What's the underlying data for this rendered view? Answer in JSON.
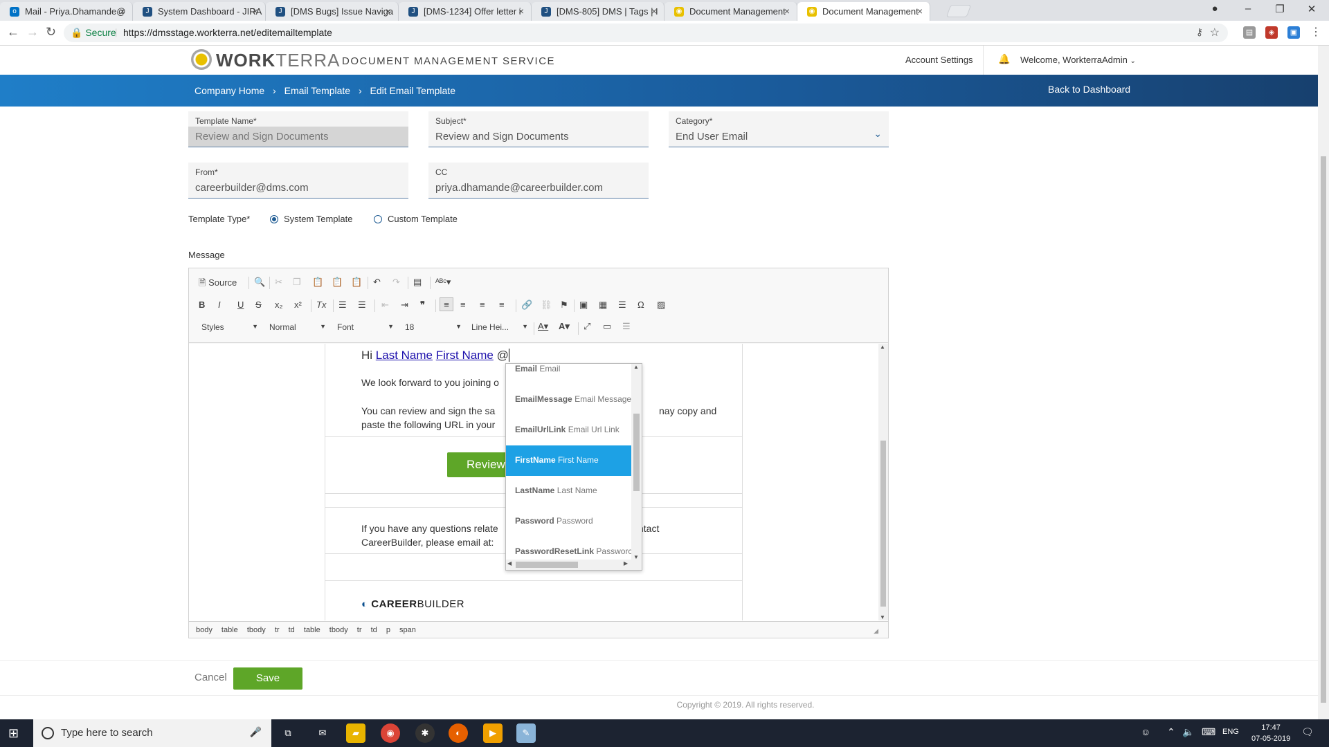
{
  "browser": {
    "tabs": [
      {
        "label": "Mail - Priya.Dhamande@",
        "icon": "outlook-icon",
        "color": "#0072c6"
      },
      {
        "label": "System Dashboard - JIRA",
        "icon": "jira-icon",
        "color": "#205081"
      },
      {
        "label": "[DMS Bugs] Issue Naviga",
        "icon": "jira-icon",
        "color": "#205081"
      },
      {
        "label": "[DMS-1234] Offer letter i",
        "icon": "jira-icon",
        "color": "#205081"
      },
      {
        "label": "[DMS-805] DMS | Tags | I",
        "icon": "jira-icon",
        "color": "#205081"
      },
      {
        "label": "Document Management",
        "icon": "workterra-icon",
        "color": "#e8c000"
      },
      {
        "label": "Document Management",
        "icon": "workterra-icon",
        "color": "#e8c000"
      }
    ],
    "secure_label": "Secure",
    "url": "https://dmsstage.workterra.net/editemailtemplate"
  },
  "header": {
    "brand_bold": "WORK",
    "brand_light": "TERRA",
    "service_title": "DOCUMENT MANAGEMENT SERVICE",
    "account_settings": "Account Settings",
    "welcome": "Welcome, WorkterraAdmin"
  },
  "nav": {
    "breadcrumb": [
      "Company Home",
      "›",
      "Email Template",
      "›",
      "Edit Email Template"
    ],
    "back_to_dashboard": "Back to Dashboard",
    "bar_color": "#1f7ec8"
  },
  "form": {
    "template_name": {
      "label": "Template Name*",
      "value": "Review and Sign Documents"
    },
    "subject": {
      "label": "Subject*",
      "value": "Review and Sign Documents"
    },
    "category": {
      "label": "Category*",
      "value": "End User Email"
    },
    "from": {
      "label": "From*",
      "value": "careerbuilder@dms.com"
    },
    "cc": {
      "label": "CC",
      "value": "priya.dhamande@careerbuilder.com"
    },
    "template_type": {
      "label": "Template Type*",
      "options": [
        "System Template",
        "Custom Template"
      ],
      "selected": "System Template"
    },
    "message_label": "Message"
  },
  "editor": {
    "source_label": "Source",
    "combos": {
      "styles": "Styles",
      "format": "Normal",
      "font": "Font",
      "size": "18",
      "line_height": "Line Hei..."
    },
    "content": {
      "greeting": "Hi",
      "last_name": "Last Name",
      "first_name": "First Name",
      "at": "@",
      "line1": "We look forward to you joining o",
      "line2a": "You can review and sign the sa",
      "line2b": "nay copy and",
      "line3": "paste the following URL in your",
      "button": "Review",
      "contact_a": "If you have any questions relate",
      "contact_b": "ntact",
      "contact_line2": "CareerBuilder, please email at:",
      "logo_bold": "CAREER",
      "logo_light": "BUILDER"
    },
    "path": [
      "body",
      "table",
      "tbody",
      "tr",
      "td",
      "table",
      "tbody",
      "tr",
      "td",
      "p",
      "span"
    ]
  },
  "mention_dropdown": {
    "items": [
      {
        "key": "Email",
        "desc": "Email"
      },
      {
        "key": "EmailMessage",
        "desc": "Email Message"
      },
      {
        "key": "EmailUrlLink",
        "desc": "Email Url Link"
      },
      {
        "key": "FirstName",
        "desc": "First Name"
      },
      {
        "key": "LastName",
        "desc": "Last Name"
      },
      {
        "key": "Password",
        "desc": "Password"
      },
      {
        "key": "PasswordResetLink",
        "desc": "Passworc"
      }
    ],
    "selected_key": "FirstName"
  },
  "actions": {
    "cancel": "Cancel",
    "save": "Save",
    "save_color": "#5ea628"
  },
  "footer": {
    "copyright": "Copyright © 2019. All rights reserved."
  },
  "taskbar": {
    "search_placeholder": "Type here to search",
    "language": "ENG",
    "time": "17:47",
    "date": "07-05-2019"
  }
}
